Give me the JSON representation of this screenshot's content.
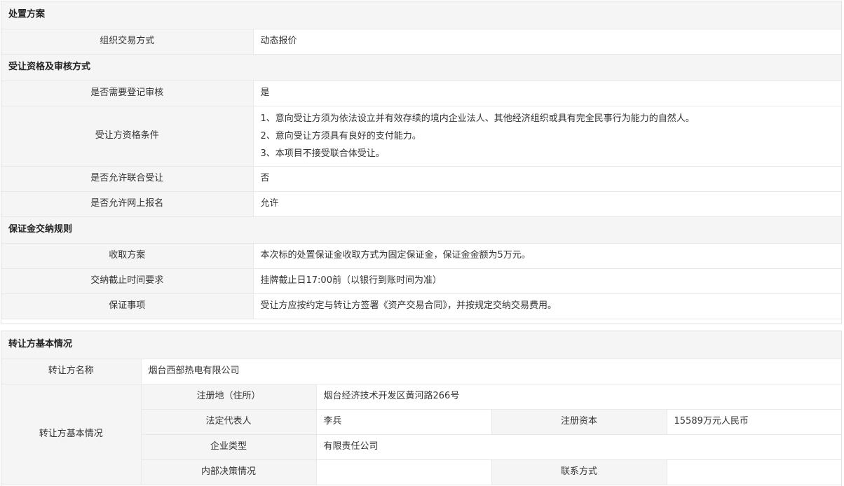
{
  "disposal": {
    "section_title": "处置方案",
    "trade_method_label": "组织交易方式",
    "trade_method_value": "动态报价"
  },
  "qualification": {
    "section_title": "受让资格及审核方式",
    "registration_review_label": "是否需要登记审核",
    "registration_review_value": "是",
    "conditions_label": "受让方资格条件",
    "conditions": [
      "1、意向受让方须为依法设立并有效存续的境内企业法人、其他经济组织或具有完全民事行为能力的自然人。",
      "2、意向受让方须具有良好的支付能力。",
      "3、本项目不接受联合体受让。"
    ],
    "joint_transfer_label": "是否允许联合受让",
    "joint_transfer_value": "否",
    "online_signup_label": "是否允许网上报名",
    "online_signup_value": "允许"
  },
  "deposit": {
    "section_title": "保证金交纳规则",
    "collection_label": "收取方案",
    "collection_value": "本次标的处置保证金收取方式为固定保证金，保证金金额为5万元。",
    "deadline_label": "交纳截止时间要求",
    "deadline_value": "挂牌截止日17:00前（以银行到账时间为准）",
    "matters_label": "保证事项",
    "matters_value": "受让方应按约定与转让方签署《资产交易合同》，并按规定交纳交易费用。"
  },
  "transferor": {
    "section_title": "转让方基本情况",
    "name_label": "转让方名称",
    "name_value": "烟台西部热电有限公司",
    "basic_label": "转让方基本情况",
    "address_label": "注册地（住所）",
    "address_value": "烟台经济技术开发区黄河路266号",
    "legal_rep_label": "法定代表人",
    "legal_rep_value": "李兵",
    "capital_label": "注册资本",
    "capital_value": "15589万元人民币",
    "company_type_label": "企业类型",
    "company_type_value": "有限责任公司",
    "internal_decision_label": "内部决策情况",
    "internal_decision_value": "",
    "contact_label": "联系方式",
    "contact_value": ""
  }
}
